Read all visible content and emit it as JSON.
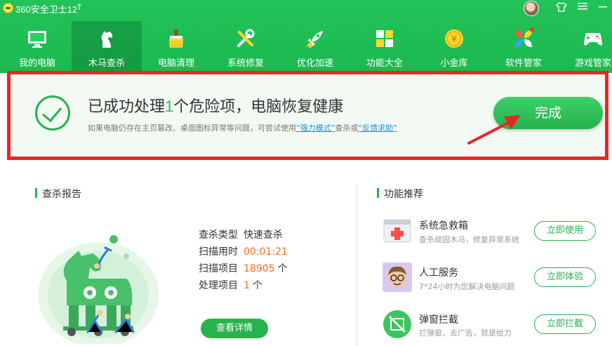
{
  "window": {
    "title": "360安全卫士12",
    "update_icon": "up-arrow-icon"
  },
  "nav": [
    {
      "label": "我的电脑",
      "icon": "monitor-icon"
    },
    {
      "label": "木马查杀",
      "icon": "horse-icon",
      "active": true
    },
    {
      "label": "电脑清理",
      "icon": "brush-icon"
    },
    {
      "label": "系统修复",
      "icon": "wrench-icon"
    },
    {
      "label": "优化加速",
      "icon": "rocket-icon"
    },
    {
      "label": "功能大全",
      "icon": "grid-icon"
    },
    {
      "label": "小金库",
      "icon": "coin-icon"
    },
    {
      "label": "软件管家",
      "icon": "apps-icon"
    },
    {
      "label": "游戏管家",
      "icon": "gamepad-icon"
    }
  ],
  "banner": {
    "title_pre": "已成功处理",
    "title_count": "1",
    "title_post": "个危险项，电脑恢复健康",
    "sub_pre": "如果电脑仍存在主页篡改、桌面图标异常等问题，可尝试使用",
    "sub_link1": "“强力模式”",
    "sub_mid": "查杀或",
    "sub_link2": "“反馈求助”",
    "done_label": "完成"
  },
  "report": {
    "title": "查杀报告",
    "scan_type_label": "查杀类型",
    "scan_type_value": "快速查杀",
    "scan_time_label": "扫描用时",
    "scan_time_value": "00:01:21",
    "scan_items_label": "扫描项目",
    "scan_items_value": "18905",
    "scan_items_unit": "个",
    "handled_label": "处理项目",
    "handled_value": "1",
    "handled_unit": "个",
    "detail_button": "查看详情"
  },
  "recommend": {
    "title": "功能推荐",
    "items": [
      {
        "name": "系统急救箱",
        "desc": "查杀顽固木马，修复异常系统",
        "button": "立即使用",
        "icon": "first-aid-kit-icon"
      },
      {
        "name": "人工服务",
        "desc": "7*24小时为您解决电脑问题",
        "button": "立即体验",
        "icon": "support-person-icon"
      },
      {
        "name": "弹窗拦截",
        "desc": "拦弹窗、去广告，就是给力",
        "button": "立即拦截",
        "icon": "popup-block-icon"
      }
    ]
  },
  "colors": {
    "brand_green": "#27b24d",
    "highlight_red": "#ee2424",
    "value_orange": "#ff6a1a",
    "link_blue": "#1a8fdc"
  }
}
